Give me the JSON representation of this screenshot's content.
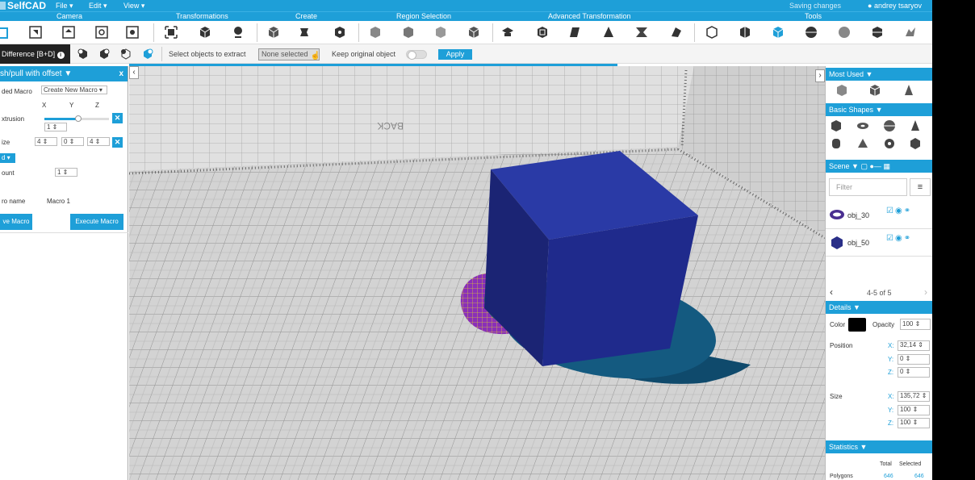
{
  "app": {
    "logo": "SelfCAD",
    "menus": [
      "File",
      "Edit",
      "View"
    ],
    "status": "Saving changes",
    "user": "andrey tsaryov"
  },
  "categories": [
    "Camera",
    "Transformations",
    "Create",
    "Region Selection",
    "Advanced Transformation",
    "Tools"
  ],
  "options": {
    "tool_label": "Difference [B+D]",
    "select_label": "Select objects to extract",
    "select_value": "None selected",
    "keep_label": "Keep original object",
    "apply": "Apply"
  },
  "left": {
    "title": "sh/pull with offset",
    "close": "x",
    "macro_label": "ded Macro",
    "macro_select": "Create New Macro",
    "axes": [
      "X",
      "Y",
      "Z"
    ],
    "extrusion_label": "xtrusion",
    "extrusion_value": "1",
    "size_label": "ize",
    "size_values": [
      "4",
      "0",
      "4"
    ],
    "dropdown": "d",
    "count_label": "ount",
    "count_value": "1",
    "name_label": "ro name",
    "name_value": "Macro 1",
    "save": "ve Macro",
    "execute": "Execute Macro"
  },
  "viewport": {
    "back_label": "BACK",
    "cube_color": "#1f2a8c",
    "disk_color": "#145a80"
  },
  "right": {
    "most_used": "Most Used",
    "basic_shapes": "Basic Shapes",
    "scene": "Scene",
    "filter_placeholder": "Filter",
    "objects": [
      {
        "name": "obj_30"
      },
      {
        "name": "obj_50"
      }
    ],
    "pager": "4-5 of 5",
    "details": "Details",
    "color_label": "Color",
    "color_value": "#000000",
    "opacity_label": "Opacity",
    "opacity_value": "100",
    "position_label": "Position",
    "position": {
      "x": "32,14",
      "y": "0",
      "z": "0"
    },
    "size_label": "Size",
    "size": {
      "x": "135,72",
      "y": "100",
      "z": "100"
    },
    "axis_x": "X:",
    "axis_y": "Y:",
    "axis_z": "Z:",
    "statistics": "Statistics",
    "stats_cols": [
      "Total",
      "Selected"
    ],
    "polygons_label": "Polygons",
    "polygons_total": "646",
    "polygons_selected": "646"
  }
}
